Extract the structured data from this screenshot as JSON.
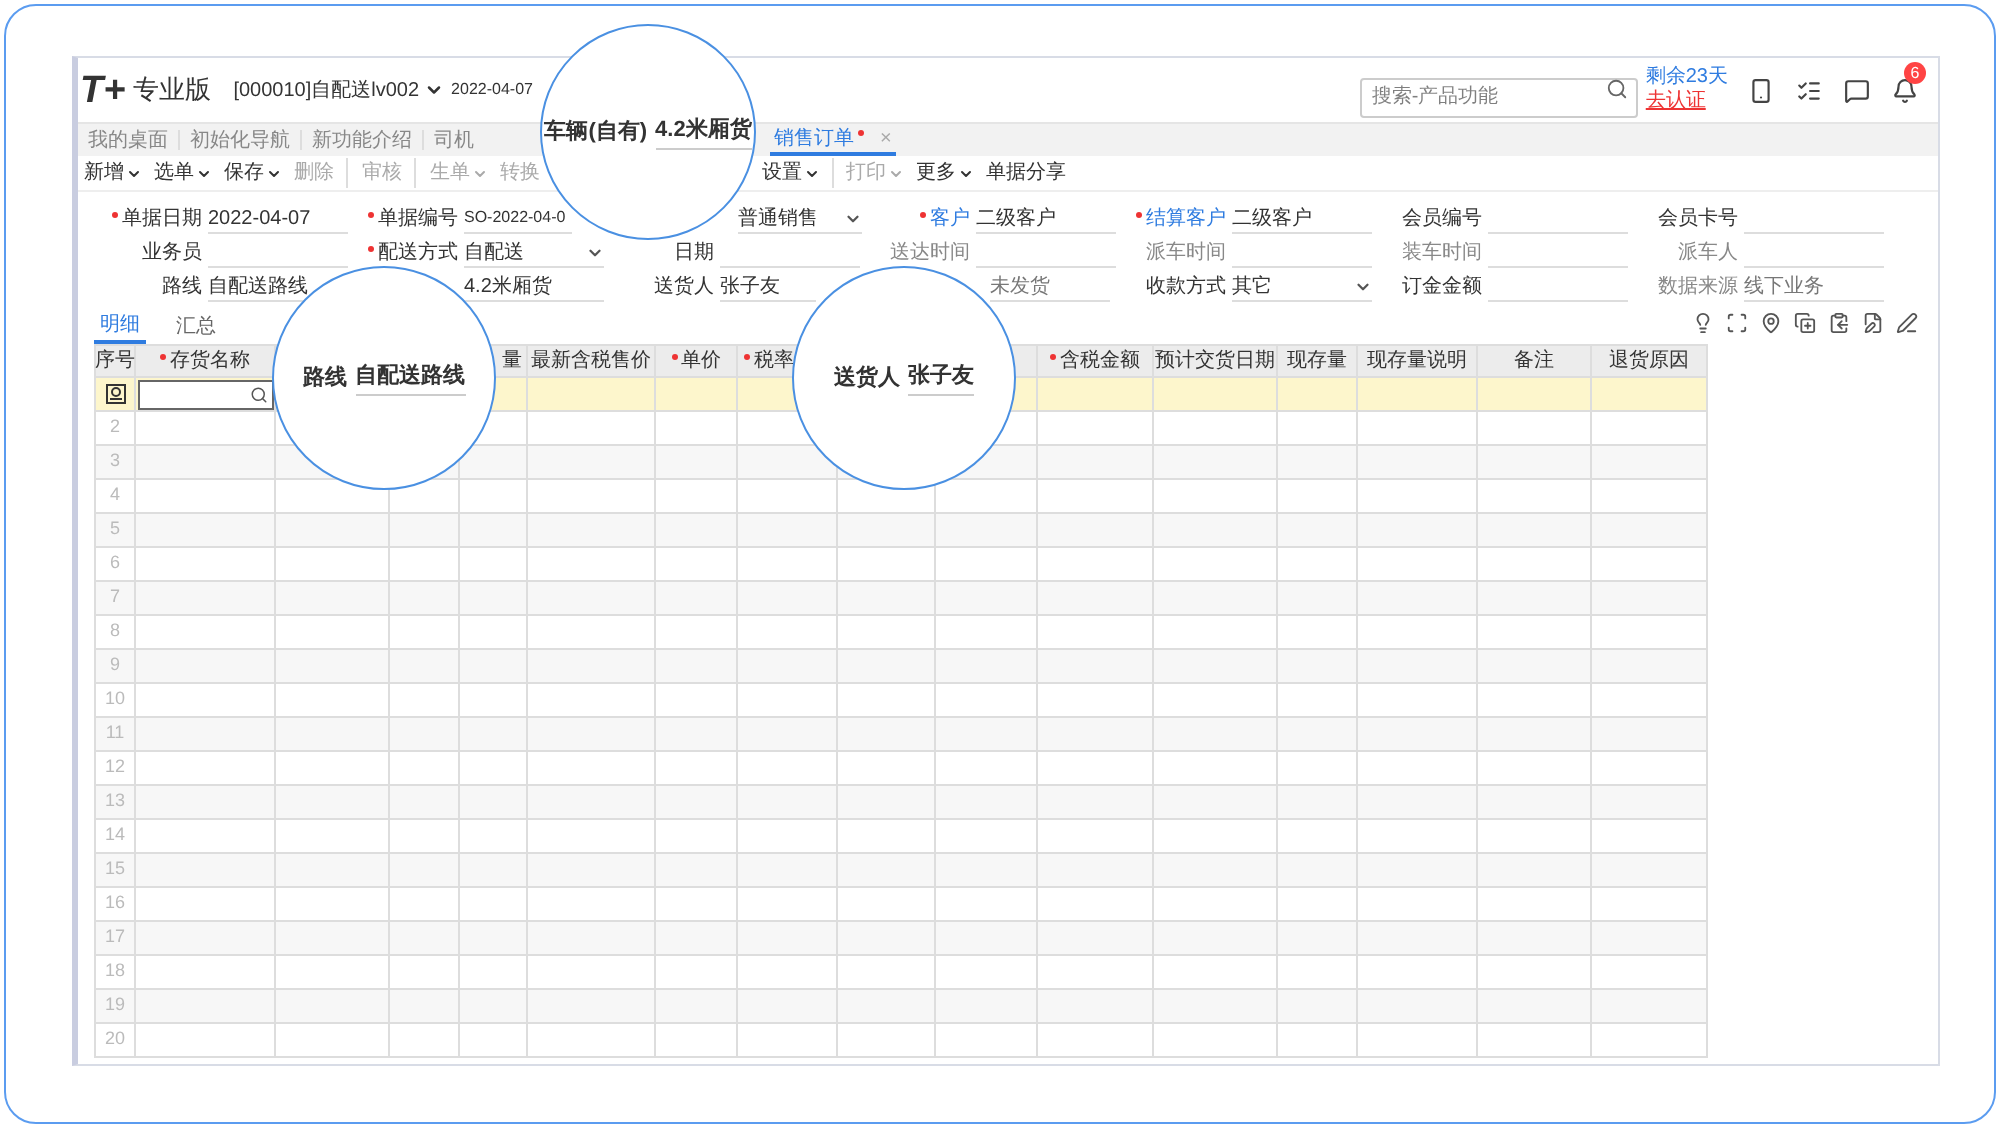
{
  "header": {
    "logo": "T+",
    "edition": "专业版",
    "account": "[000010]自配送lv002",
    "date": "2022-04-07",
    "search": {
      "placeholder": "搜索-产品功能"
    },
    "trial": "剩余23天",
    "certify": "去认证",
    "notification_count": "6"
  },
  "tabs": [
    {
      "label": "我的桌面",
      "selected": false,
      "modified": false
    },
    {
      "label": "初始化导航",
      "selected": false,
      "modified": false
    },
    {
      "label": "新功能介绍",
      "selected": false,
      "modified": false
    },
    {
      "label": "司机",
      "selected": false,
      "modified": false
    },
    {
      "label": "销售订单",
      "selected": true,
      "modified": true,
      "close": "×"
    }
  ],
  "toolbar": [
    {
      "label": "新增",
      "dropdown": true,
      "disabled": false,
      "divider_after": false
    },
    {
      "label": "选单",
      "dropdown": true,
      "disabled": false,
      "divider_after": false
    },
    {
      "label": "保存",
      "dropdown": true,
      "disabled": false,
      "divider_after": false
    },
    {
      "label": "删除",
      "dropdown": false,
      "disabled": true,
      "divider_after": true
    },
    {
      "label": "审核",
      "dropdown": false,
      "disabled": true,
      "divider_after": true
    },
    {
      "label": "生单",
      "dropdown": true,
      "disabled": true,
      "divider_after": false
    },
    {
      "label": "转换",
      "dropdown": false,
      "disabled": true,
      "divider_after": false
    },
    {
      "label": "设置",
      "dropdown": true,
      "disabled": false,
      "divider_after": true
    },
    {
      "label": "打印",
      "dropdown": true,
      "disabled": true,
      "divider_after": false
    },
    {
      "label": "更多",
      "dropdown": true,
      "disabled": false,
      "divider_after": false
    },
    {
      "label": "单据分享",
      "dropdown": false,
      "disabled": false,
      "divider_after": false
    }
  ],
  "form": [
    [
      {
        "label": "单据日期",
        "value": "2022-04-07",
        "required": true,
        "kind": "plain",
        "dropdown": false
      },
      {
        "label": "单据编号",
        "value": "SO-2022-04-0",
        "required": true,
        "kind": "plain",
        "dropdown": false
      },
      {
        "value": "普通销售",
        "kind": "plain",
        "dropdown": true
      },
      {
        "label": "客户",
        "value": "二级客户",
        "required": true,
        "kind": "link",
        "dropdown": false
      },
      {
        "label": "结算客户",
        "value": "二级客户",
        "required": true,
        "kind": "link",
        "dropdown": false
      },
      {
        "label": "会员编号",
        "required": false,
        "kind": "plain",
        "dropdown": false
      },
      {
        "label": "会员卡号",
        "required": false,
        "kind": "plain",
        "dropdown": false
      }
    ],
    [
      {
        "label": "业务员",
        "required": false,
        "kind": "plain",
        "dropdown": false
      },
      {
        "label": "配送方式",
        "value": "自配送",
        "required": true,
        "kind": "plain",
        "dropdown": true
      },
      {
        "label": "日期",
        "required": false,
        "kind": "plain",
        "dropdown": false
      },
      {
        "label": "送达时间",
        "required": false,
        "kind": "muted",
        "dropdown": false
      },
      {
        "label": "派车时间",
        "required": false,
        "kind": "muted",
        "dropdown": false
      },
      {
        "label": "装车时间",
        "required": false,
        "kind": "muted",
        "dropdown": false
      },
      {
        "label": "派车人",
        "required": false,
        "kind": "muted",
        "dropdown": false
      }
    ],
    [
      {
        "label": "路线",
        "value": "自配送路线",
        "required": false,
        "kind": "plain",
        "dropdown": false
      },
      {
        "value": "4.2米厢货",
        "kind": "plain",
        "dropdown": false
      },
      {
        "label": "送货人",
        "value": "张子友",
        "required": false,
        "kind": "plain",
        "dropdown": false
      },
      {
        "value": "未发货",
        "kind": "muted",
        "dropdown": false
      },
      {
        "label": "收款方式",
        "value": "其它",
        "required": false,
        "kind": "plain",
        "dropdown": true
      },
      {
        "label": "订金金额",
        "required": false,
        "kind": "plain",
        "dropdown": false
      },
      {
        "label": "数据来源",
        "value": "线下业务",
        "required": false,
        "kind": "muted",
        "dropdown": false
      }
    ]
  ],
  "detail_tabs": [
    {
      "label": "明细",
      "selected": true
    },
    {
      "label": "汇总",
      "selected": false
    }
  ],
  "table": {
    "columns": [
      {
        "label": "序号",
        "required": false
      },
      {
        "label": "存货名称",
        "required": true
      },
      {},
      {},
      {
        "label": "量",
        "required": false
      },
      {
        "label": "最新含税售价",
        "required": false
      },
      {
        "label": "单价",
        "required": true
      },
      {
        "label": "税率",
        "required": true
      },
      {},
      {},
      {
        "label": "含税金额",
        "required": true
      },
      {
        "label": "预计交货日期",
        "required": false
      },
      {
        "label": "现存量",
        "required": false
      },
      {
        "label": "现存量说明",
        "required": false
      },
      {
        "label": "备注",
        "required": false
      },
      {
        "label": "退货原因",
        "required": false
      }
    ],
    "rows": [
      {
        "kind": "entry"
      },
      {
        "kind": "blank",
        "number": "2"
      },
      {
        "kind": "blank",
        "number": "3"
      },
      {
        "kind": "blank",
        "number": "4"
      },
      {
        "kind": "blank",
        "number": "5"
      },
      {
        "kind": "blank",
        "number": "6"
      },
      {
        "kind": "blank",
        "number": "7"
      },
      {
        "kind": "blank",
        "number": "8"
      },
      {
        "kind": "blank",
        "number": "9"
      },
      {
        "kind": "blank",
        "number": "10"
      },
      {
        "kind": "blank",
        "number": "11"
      },
      {
        "kind": "blank",
        "number": "12"
      },
      {
        "kind": "blank",
        "number": "13"
      },
      {
        "kind": "blank",
        "number": "14"
      },
      {
        "kind": "blank",
        "number": "15"
      },
      {
        "kind": "blank",
        "number": "16"
      },
      {
        "kind": "blank",
        "number": "17"
      },
      {
        "kind": "blank",
        "number": "18"
      },
      {
        "kind": "blank",
        "number": "19"
      },
      {
        "kind": "blank",
        "number": "20"
      }
    ]
  },
  "callouts": [
    {
      "label": "车辆(自有)",
      "value": "4.2米厢货"
    },
    {
      "label": "路线",
      "value": "自配送路线"
    },
    {
      "label": "送货人",
      "value": "张子友"
    }
  ]
}
